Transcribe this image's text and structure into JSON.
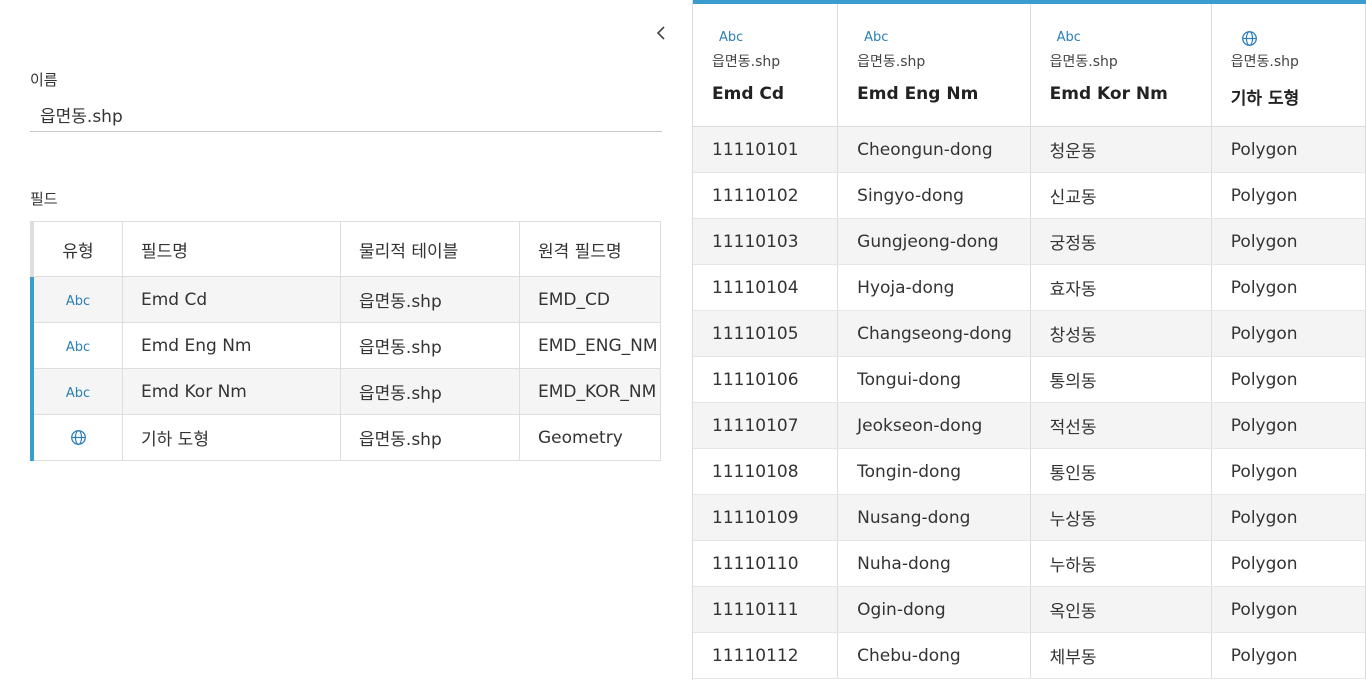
{
  "left": {
    "name_label": "이름",
    "name_value": "읍면동.shp",
    "fields_label": "필드",
    "columns": {
      "type": "유형",
      "field_name": "필드명",
      "physical_table": "물리적 테이블",
      "remote_field": "원격 필드명"
    },
    "rows": [
      {
        "type_label": "Abc",
        "type_icon": "string-type",
        "field_name": "Emd Cd",
        "physical_table": "읍면동.shp",
        "remote_field": "EMD_CD"
      },
      {
        "type_label": "Abc",
        "type_icon": "string-type",
        "field_name": "Emd Eng Nm",
        "physical_table": "읍면동.shp",
        "remote_field": "EMD_ENG_NM"
      },
      {
        "type_label": "Abc",
        "type_icon": "string-type",
        "field_name": "Emd Kor Nm",
        "physical_table": "읍면동.shp",
        "remote_field": "EMD_KOR_NM"
      },
      {
        "type_label": "",
        "type_icon": "globe-icon",
        "field_name": "기하 도형",
        "physical_table": "읍면동.shp",
        "remote_field": "Geometry"
      }
    ]
  },
  "grid": {
    "columns": [
      {
        "type_label": "Abc",
        "type_icon": "string-type",
        "source": "읍면동.shp",
        "name": "Emd Cd"
      },
      {
        "type_label": "Abc",
        "type_icon": "string-type",
        "source": "읍면동.shp",
        "name": "Emd Eng Nm"
      },
      {
        "type_label": "Abc",
        "type_icon": "string-type",
        "source": "읍면동.shp",
        "name": "Emd Kor Nm"
      },
      {
        "type_label": "",
        "type_icon": "globe-icon",
        "source": "읍면동.shp",
        "name": "기하 도형"
      }
    ],
    "rows": [
      [
        "11110101",
        "Cheongun-dong",
        "청운동",
        "Polygon"
      ],
      [
        "11110102",
        "Singyo-dong",
        "신교동",
        "Polygon"
      ],
      [
        "11110103",
        "Gungjeong-dong",
        "궁정동",
        "Polygon"
      ],
      [
        "11110104",
        "Hyoja-dong",
        "효자동",
        "Polygon"
      ],
      [
        "11110105",
        "Changseong-dong",
        "창성동",
        "Polygon"
      ],
      [
        "11110106",
        "Tongui-dong",
        "통의동",
        "Polygon"
      ],
      [
        "11110107",
        "Jeokseon-dong",
        "적선동",
        "Polygon"
      ],
      [
        "11110108",
        "Tongin-dong",
        "통인동",
        "Polygon"
      ],
      [
        "11110109",
        "Nusang-dong",
        "누상동",
        "Polygon"
      ],
      [
        "11110110",
        "Nuha-dong",
        "누하동",
        "Polygon"
      ],
      [
        "11110111",
        "Ogin-dong",
        "옥인동",
        "Polygon"
      ],
      [
        "11110112",
        "Chebu-dong",
        "체부동",
        "Polygon"
      ]
    ]
  },
  "colors": {
    "accent": "#3a9dcd",
    "type_text": "#2a7fb8",
    "stripe": "#f4f4f4",
    "border": "#dcdcdc"
  }
}
